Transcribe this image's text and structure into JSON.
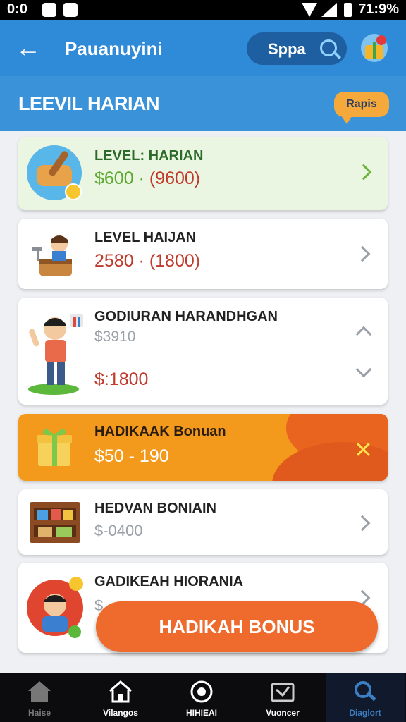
{
  "status_bar": {
    "time": "0:0",
    "right_text": "71:9%"
  },
  "app_bar": {
    "back_label": "←",
    "title": "Pauanuyini",
    "search_label": "Sppa"
  },
  "section": {
    "title": "LEEVIL HARIAN",
    "badge": "Rapis"
  },
  "cards": [
    {
      "title": "LEVEL: HARIAN",
      "value": "$600",
      "value_sep": " · ",
      "value_paren": "(9600)"
    },
    {
      "title": "LEVEL HAIJAN",
      "value": "2580 · (1800)"
    },
    {
      "title": "GODIURAN HARANDHGAN",
      "value_small": "$3910",
      "value_big": "$:1800"
    },
    {
      "title": "HADIKAAK Bonuan",
      "value": "$50 - 190",
      "close": "✕"
    },
    {
      "title": "HEDVAN BONIAIN",
      "value": "$-0400"
    },
    {
      "title": "GADIKEAH HIORANIA",
      "value": "$"
    }
  ],
  "fab": {
    "label": "HADIKAH BONUS"
  },
  "bottom_nav": [
    {
      "label": "Haise",
      "icon": "home-icon"
    },
    {
      "label": "Vilangos",
      "icon": "home-outline-icon"
    },
    {
      "label": "HIHIEAI",
      "icon": "compass-icon"
    },
    {
      "label": "Vuoncer",
      "icon": "inbox-icon"
    },
    {
      "label": "Diaglort",
      "icon": "search-icon"
    }
  ],
  "colors": {
    "primary": "#2f8ad8",
    "accent": "#ee6a2d",
    "price_red": "#c0392b",
    "green": "#5da82f"
  }
}
